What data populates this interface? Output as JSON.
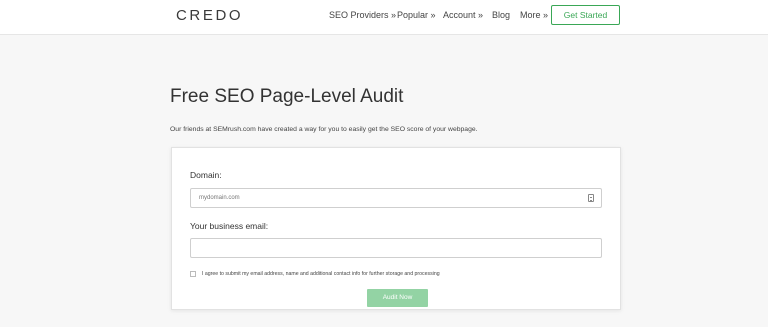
{
  "header": {
    "logo": "CREDO",
    "nav": [
      {
        "label": "SEO Providers »"
      },
      {
        "label": "Popular »"
      },
      {
        "label": "Account »"
      },
      {
        "label": "Blog"
      },
      {
        "label": "More »"
      }
    ],
    "cta_label": "Get Started",
    "accent_color": "#3aa756"
  },
  "main": {
    "title": "Free SEO Page-Level Audit",
    "intro": "Our friends at SEMrush.com have created a way for you to easily get the SEO score of your webpage."
  },
  "form": {
    "domain_label": "Domain:",
    "domain_placeholder": "mydomain.com",
    "domain_icon": "contact-card-icon",
    "email_label": "Your business email:",
    "email_value": "",
    "consent_text": "I agree to submit my email address, name and additional contact info for further storage and processing",
    "consent_checked": false,
    "submit_label": "Audit Now",
    "submit_color": "#93d3a4"
  }
}
